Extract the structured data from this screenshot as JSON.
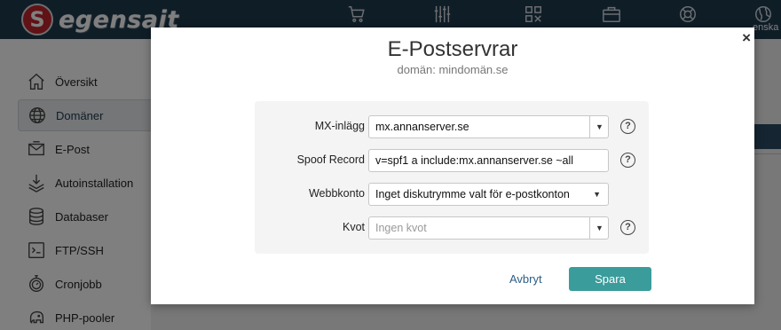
{
  "brand": {
    "logo_letter": "S",
    "logo_text": "egensajt"
  },
  "topnav": {
    "icons": [
      "cart-icon",
      "sliders-icon",
      "qr-grid-icon",
      "briefcase-icon",
      "lifebuoy-icon",
      "globe-icon"
    ],
    "language_label": "enska"
  },
  "sidebar": {
    "items": [
      {
        "label": "Översikt",
        "icon": "home-icon"
      },
      {
        "label": "Domäner",
        "icon": "globe-icon"
      },
      {
        "label": "E-Post",
        "icon": "mail-icon"
      },
      {
        "label": "Autoinstallation",
        "icon": "download-icon"
      },
      {
        "label": "Databaser",
        "icon": "database-icon"
      },
      {
        "label": "FTP/SSH",
        "icon": "terminal-icon"
      },
      {
        "label": "Cronjobb",
        "icon": "stopwatch-icon"
      },
      {
        "label": "PHP-pooler",
        "icon": "elephant-icon"
      }
    ],
    "active_index": 1
  },
  "modal": {
    "title": "E-Postservrar",
    "subtitle": "domän: mindomän.se",
    "close_label": "×",
    "fields": {
      "mx": {
        "label": "MX-inlägg",
        "value": "mx.annanserver.se"
      },
      "spf": {
        "label": "Spoof Record",
        "value": "v=spf1 a include:mx.annanserver.se ~all"
      },
      "webbkonto": {
        "label": "Webbkonto",
        "value": "Inget diskutrymme valt för e-postkonton"
      },
      "kvot": {
        "label": "Kvot",
        "placeholder": "Ingen kvot"
      }
    },
    "help_label": "?",
    "cancel_label": "Avbryt",
    "save_label": "Spara"
  },
  "colors": {
    "topbar": "#1f3a4f",
    "logo_red": "#c0242d",
    "save_button": "#3a9c9b",
    "cancel_link": "#2d5e87"
  }
}
